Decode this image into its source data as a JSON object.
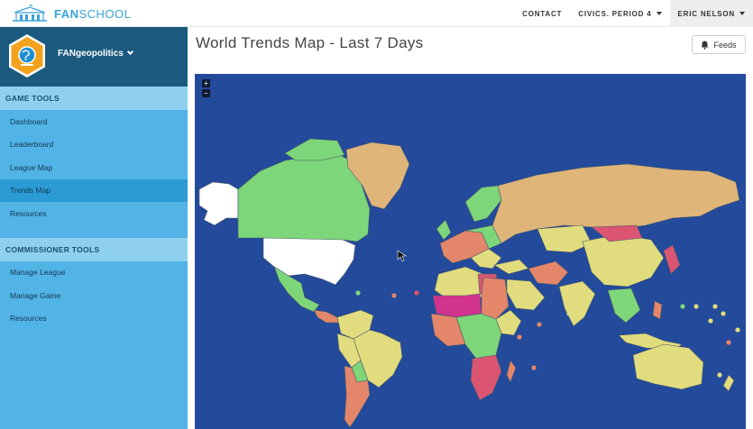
{
  "brand": {
    "name_bold": "FAN",
    "name_light": "SCHOOL"
  },
  "topnav": {
    "contact": "CONTACT",
    "class_select": "CIVICS. PERIOD 4",
    "user_menu": "ERIC NELSON"
  },
  "sidebar": {
    "team_name": "FANgeopolitics",
    "game_tools_title": "GAME TOOLS",
    "game_tools": [
      {
        "label": "Dashboard"
      },
      {
        "label": "Leaderboard"
      },
      {
        "label": "League Map"
      },
      {
        "label": "Trends Map"
      },
      {
        "label": "Resources"
      }
    ],
    "commissioner_title": "COMMISSIONER TOOLS",
    "commissioner_tools": [
      {
        "label": "Manage League"
      },
      {
        "label": "Manage Game"
      },
      {
        "label": "Resources"
      }
    ]
  },
  "main": {
    "title": "World Trends Map - Last 7 Days",
    "feeds_label": "Feeds",
    "zoom_in": "+",
    "zoom_out": "−"
  },
  "colors": {
    "ocean": "#234a9b",
    "green": "#7ed67a",
    "tan": "#dfb57a",
    "yellow": "#e1dc7e",
    "orange": "#e4866a",
    "red": "#db5572",
    "magenta": "#d2338c",
    "white": "#ffffff"
  }
}
